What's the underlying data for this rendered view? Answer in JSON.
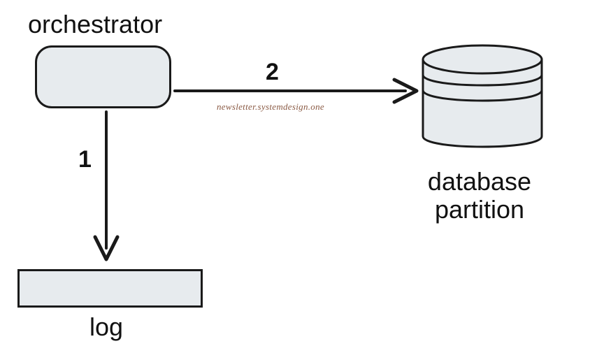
{
  "diagram": {
    "nodes": {
      "orchestrator": {
        "label": "orchestrator"
      },
      "database": {
        "label": "database\npartition"
      },
      "log": {
        "label": "log"
      }
    },
    "edges": {
      "orch_to_log": {
        "label": "1"
      },
      "orch_to_db": {
        "label": "2"
      }
    },
    "watermark": "newsletter.systemdesign.one"
  }
}
